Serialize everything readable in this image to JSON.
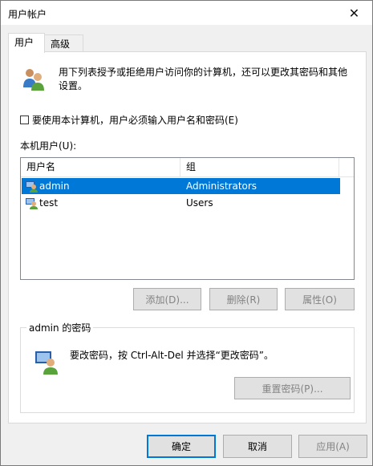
{
  "window": {
    "title": "用户帐户"
  },
  "tabs": [
    {
      "label": "用户"
    },
    {
      "label": "高级"
    }
  ],
  "intro_text": "用下列表授予或拒绝用户访问你的计算机，还可以更改其密码和其他设置。",
  "checkbox": {
    "label": "要使用本计算机，用户必须输入用户名和密码(E)",
    "checked": false
  },
  "local_users_label": "本机用户(U):",
  "users_table": {
    "columns": [
      "用户名",
      "组"
    ],
    "rows": [
      {
        "username": "admin",
        "group": "Administrators",
        "selected": true
      },
      {
        "username": "test",
        "group": "Users",
        "selected": false
      }
    ]
  },
  "user_buttons": {
    "add": "添加(D)...",
    "remove": "删除(R)",
    "properties": "属性(O)"
  },
  "password_group": {
    "label": "admin 的密码",
    "text": "要改密码，按 Ctrl-Alt-Del 并选择“更改密码”。",
    "reset_button": "重置密码(P)..."
  },
  "dialog_buttons": {
    "ok": "确定",
    "cancel": "取消",
    "apply": "应用(A)"
  },
  "colors": {
    "selection": "#0078d7",
    "default_button_border": "#0078d7",
    "panel_bg": "#ffffff",
    "window_bg": "#f0f0f0"
  }
}
